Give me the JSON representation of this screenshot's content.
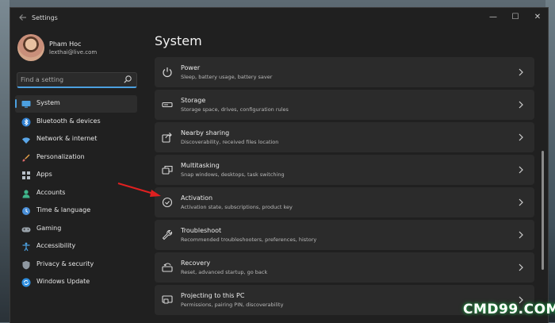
{
  "window": {
    "app_title": "Settings",
    "controls": {
      "minimize": "—",
      "maximize": "☐",
      "close": "✕"
    }
  },
  "user": {
    "name": "Pham Hoc",
    "email": "lexthai@live.com"
  },
  "search": {
    "placeholder": "Find a setting",
    "icon": "search-icon"
  },
  "sidebar": {
    "items": [
      {
        "label": "System",
        "icon": "monitor-icon",
        "active": true
      },
      {
        "label": "Bluetooth & devices",
        "icon": "bluetooth-icon"
      },
      {
        "label": "Network & internet",
        "icon": "wifi-icon"
      },
      {
        "label": "Personalization",
        "icon": "brush-icon"
      },
      {
        "label": "Apps",
        "icon": "apps-icon"
      },
      {
        "label": "Accounts",
        "icon": "person-icon"
      },
      {
        "label": "Time & language",
        "icon": "globe-clock-icon"
      },
      {
        "label": "Gaming",
        "icon": "gamepad-icon"
      },
      {
        "label": "Accessibility",
        "icon": "accessibility-icon"
      },
      {
        "label": "Privacy & security",
        "icon": "shield-icon"
      },
      {
        "label": "Windows Update",
        "icon": "update-icon"
      }
    ]
  },
  "main": {
    "title": "System",
    "cards": [
      {
        "title": "Power",
        "subtitle": "Sleep, battery usage, battery saver",
        "icon": "power-icon"
      },
      {
        "title": "Storage",
        "subtitle": "Storage space, drives, configuration rules",
        "icon": "storage-icon"
      },
      {
        "title": "Nearby sharing",
        "subtitle": "Discoverability, received files location",
        "icon": "share-icon"
      },
      {
        "title": "Multitasking",
        "subtitle": "Snap windows, desktops, task switching",
        "icon": "multitask-icon"
      },
      {
        "title": "Activation",
        "subtitle": "Activation state, subscriptions, product key",
        "icon": "check-circle-icon"
      },
      {
        "title": "Troubleshoot",
        "subtitle": "Recommended troubleshooters, preferences, history",
        "icon": "wrench-icon"
      },
      {
        "title": "Recovery",
        "subtitle": "Reset, advanced startup, go back",
        "icon": "recovery-icon"
      },
      {
        "title": "Projecting to this PC",
        "subtitle": "Permissions, pairing PIN, discoverability",
        "icon": "projecting-icon"
      }
    ]
  },
  "watermark": "CMD99.COM",
  "colors": {
    "accent": "#4ca0e0",
    "background": "#202020",
    "card": "#2b2b2b",
    "annotation_arrow": "#e02020",
    "watermark_glow": "#1e8e3e"
  }
}
